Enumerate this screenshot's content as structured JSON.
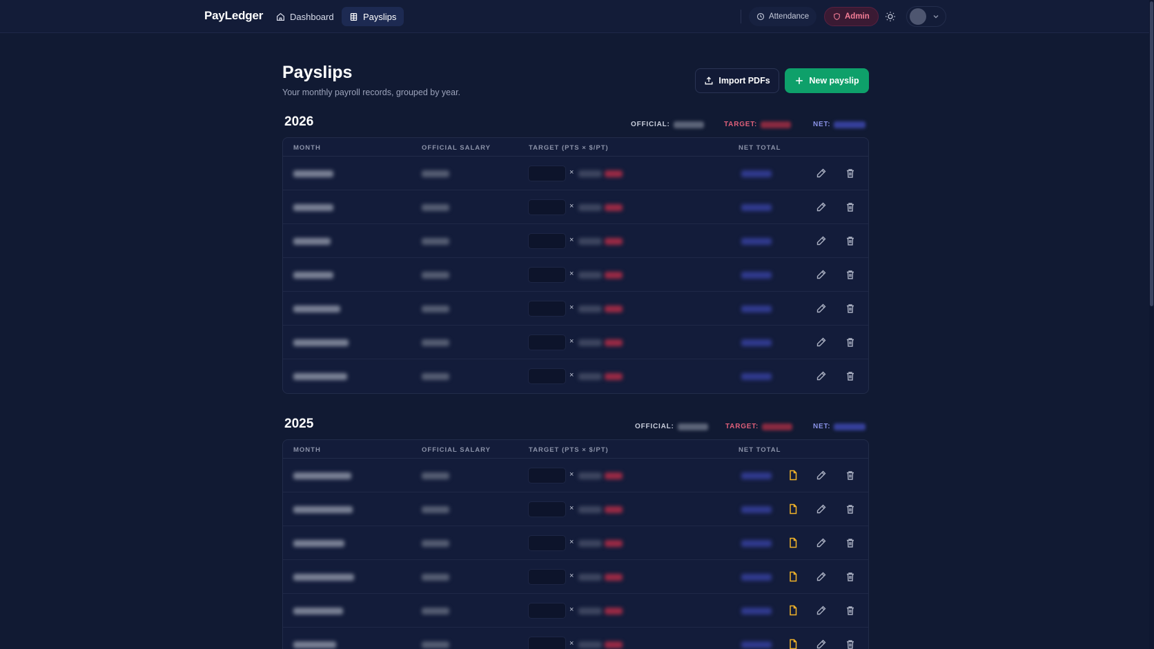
{
  "nav": {
    "brand": "PayLedger",
    "links": [
      {
        "label": "Dashboard",
        "icon": "home-icon",
        "active": false
      },
      {
        "label": "Payslips",
        "icon": "receipt-icon",
        "active": true
      }
    ],
    "attendance_label": "Attendance",
    "admin_label": "Admin"
  },
  "header": {
    "title": "Payslips",
    "subtitle": "Your monthly payroll records, grouped by year.",
    "import_label": "Import PDFs",
    "new_label": "New payslip"
  },
  "columns": {
    "month": "MONTH",
    "official": "OFFICIAL SALARY",
    "target": "TARGET (PTS × $/PT)",
    "net": "NET TOTAL"
  },
  "totals_labels": {
    "official": "OFFICIAL:",
    "target": "TARGET:",
    "net": "NET:"
  },
  "times_symbol": "×",
  "years": [
    {
      "year": "2026",
      "rows": 7,
      "has_pdf": false
    },
    {
      "year": "2025",
      "rows": 6,
      "has_pdf": true
    }
  ],
  "colors": {
    "background": "#111a33",
    "accent_green": "#0ea06a",
    "target_red": "#e0607a",
    "net_blue": "#8a93e8",
    "pdf_yellow": "#f2b328"
  }
}
